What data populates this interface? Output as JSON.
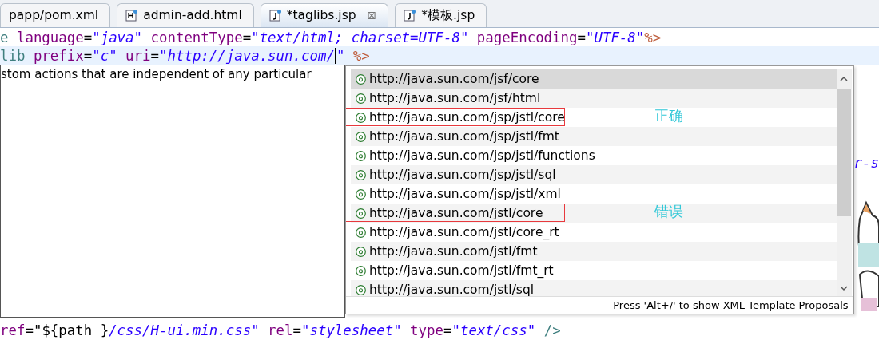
{
  "tabs": [
    {
      "label": "papp/pom.xml",
      "kind": "xml",
      "selected": false
    },
    {
      "label": "admin-add.html",
      "kind": "html",
      "selected": false
    },
    {
      "label": "*taglibs.jsp",
      "kind": "jsp",
      "selected": true,
      "close": "⊠"
    },
    {
      "label": "*模板.jsp",
      "kind": "jsp",
      "selected": false
    }
  ],
  "code_top": [
    {
      "current": false,
      "tokens": [
        {
          "kind": "keyword",
          "text": "e "
        },
        {
          "kind": "attr",
          "text": "language"
        },
        {
          "kind": "plain",
          "text": "="
        },
        {
          "kind": "string",
          "text": "\"java\" "
        },
        {
          "kind": "attr",
          "text": "contentType"
        },
        {
          "kind": "plain",
          "text": "="
        },
        {
          "kind": "string",
          "text": "\"text/html; charset=UTF-8\" "
        },
        {
          "kind": "attr",
          "text": "pageEncoding"
        },
        {
          "kind": "plain",
          "text": "="
        },
        {
          "kind": "string",
          "text": "\"UTF-8\""
        },
        {
          "kind": "delim",
          "text": "%>"
        }
      ]
    },
    {
      "current": true,
      "tokens": [
        {
          "kind": "keyword",
          "text": "lib "
        },
        {
          "kind": "attr",
          "text": "prefix"
        },
        {
          "kind": "plain",
          "text": "="
        },
        {
          "kind": "string",
          "text": "\"c\" "
        },
        {
          "kind": "attr",
          "text": "uri"
        },
        {
          "kind": "plain",
          "text": "="
        },
        {
          "kind": "string",
          "text": "\"http://java.sun.com/",
          "cursor": true
        },
        {
          "kind": "string",
          "text": "\" "
        },
        {
          "kind": "delim",
          "text": "%>"
        }
      ]
    }
  ],
  "hover_doc": "stom actions that are independent of any particular",
  "proposals": {
    "items": [
      {
        "text": "http://java.sun.com/jsf/core",
        "selected": true
      },
      {
        "text": "http://java.sun.com/jsf/html",
        "selected": false
      },
      {
        "text": "http://java.sun.com/jsp/jstl/core",
        "selected": false,
        "marked": true,
        "note": "正确"
      },
      {
        "text": "http://java.sun.com/jsp/jstl/fmt",
        "selected": false
      },
      {
        "text": "http://java.sun.com/jsp/jstl/functions",
        "selected": false
      },
      {
        "text": "http://java.sun.com/jsp/jstl/sql",
        "selected": false
      },
      {
        "text": "http://java.sun.com/jsp/jstl/xml",
        "selected": false
      },
      {
        "text": "http://java.sun.com/jstl/core",
        "selected": false,
        "marked": true,
        "note": "错误"
      },
      {
        "text": "http://java.sun.com/jstl/core_rt",
        "selected": false
      },
      {
        "text": "http://java.sun.com/jstl/fmt",
        "selected": false
      },
      {
        "text": "http://java.sun.com/jstl/fmt_rt",
        "selected": false
      },
      {
        "text": "http://java.sun.com/jstl/sql",
        "selected": false
      }
    ],
    "status": "Press 'Alt+/' to show XML Template Proposals"
  },
  "side_code": "r-s",
  "code_bottom": {
    "tokens": [
      {
        "kind": "attr",
        "text": "ref"
      },
      {
        "kind": "plain",
        "text": "="
      },
      {
        "kind": "plain",
        "text": "\"${path }"
      },
      {
        "kind": "string",
        "text": "/css/H-ui.min.css\" "
      },
      {
        "kind": "attr",
        "text": "rel"
      },
      {
        "kind": "plain",
        "text": "="
      },
      {
        "kind": "string",
        "text": "\"stylesheet\" "
      },
      {
        "kind": "attr",
        "text": "type"
      },
      {
        "kind": "plain",
        "text": "="
      },
      {
        "kind": "string",
        "text": "\"text/css\" "
      },
      {
        "kind": "keyword",
        "text": "/>"
      }
    ]
  }
}
